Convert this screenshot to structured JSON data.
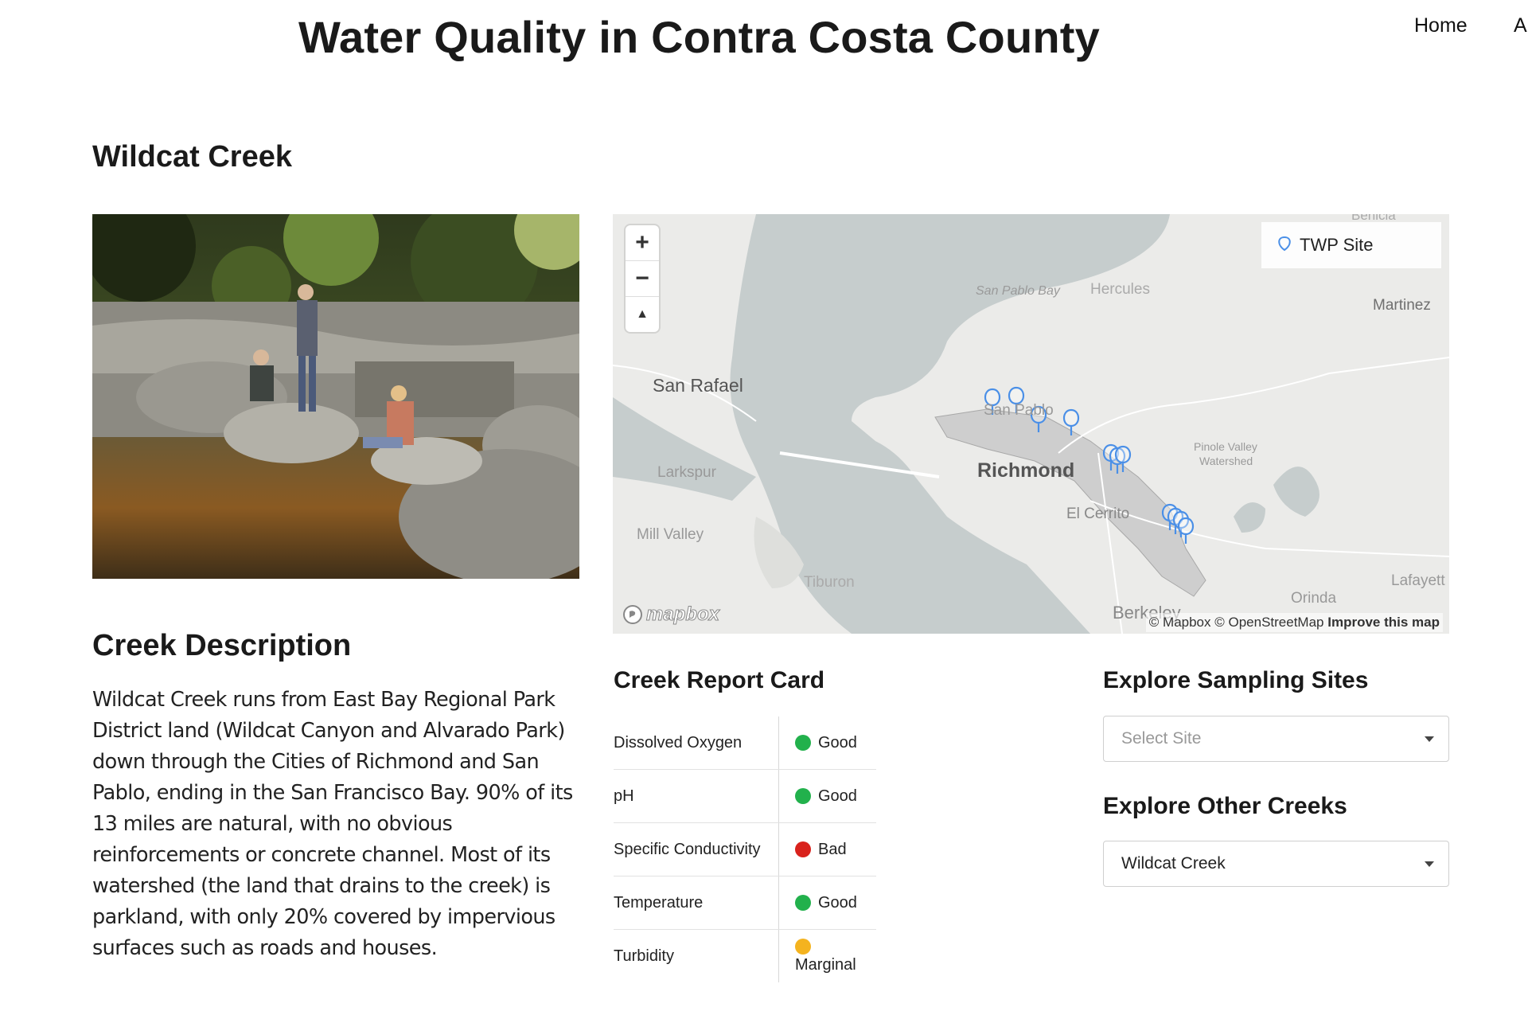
{
  "header": {
    "title": "Water Quality in Contra Costa County",
    "nav": [
      {
        "label": "Home"
      },
      {
        "label": "A"
      }
    ]
  },
  "creek": {
    "name": "Wildcat Creek"
  },
  "map": {
    "zoom_in": "+",
    "zoom_out": "−",
    "compass": "▲",
    "legend_label": "TWP Site",
    "places": {
      "san_pablo_bay": "San Pablo Bay",
      "hercules": "Hercules",
      "martinez": "Martinez",
      "benicia": "Benicia",
      "san_rafael": "San Rafael",
      "san_pablo": "San Pablo",
      "richmond": "Richmond",
      "pinole_valley": "Pinole Valley",
      "watershed": "Watershed",
      "larkspur": "Larkspur",
      "el_cerrito": "El Cerrito",
      "mill_valley": "Mill Valley",
      "tiburon": "Tiburon",
      "lafayette": "Lafayett",
      "orinda": "Orinda",
      "berkeley": "Berkeley"
    },
    "logo": "mapbox",
    "attribution": "© Mapbox © OpenStreetMap",
    "improve": "Improve this map"
  },
  "description": {
    "heading": "Creek Description",
    "text": "Wildcat Creek runs from East Bay Regional Park District land (Wildcat Canyon and Alvarado Park) down through the Cities of Richmond and San Pablo, ending in the San Francisco Bay. 90% of its 13 miles are natural, with no obvious reinforcements or concrete channel. Most of its watershed (the land that drains to the creek) is parkland, with only 20% covered by impervious surfaces such as roads and houses."
  },
  "report_card": {
    "heading": "Creek Report Card",
    "rows": [
      {
        "parameter": "Dissolved Oxygen",
        "status": "Good",
        "color": "#22b14c"
      },
      {
        "parameter": "pH",
        "status": "Good",
        "color": "#22b14c"
      },
      {
        "parameter": "Specific Conductivity",
        "status": "Bad",
        "color": "#d9221c"
      },
      {
        "parameter": "Temperature",
        "status": "Good",
        "color": "#22b14c"
      },
      {
        "parameter": "Turbidity",
        "status": "Marginal",
        "color": "#f4b31f"
      }
    ]
  },
  "explore": {
    "sites_heading": "Explore Sampling Sites",
    "sites_placeholder": "Select Site",
    "creeks_heading": "Explore Other Creeks",
    "creeks_value": "Wildcat Creek"
  }
}
